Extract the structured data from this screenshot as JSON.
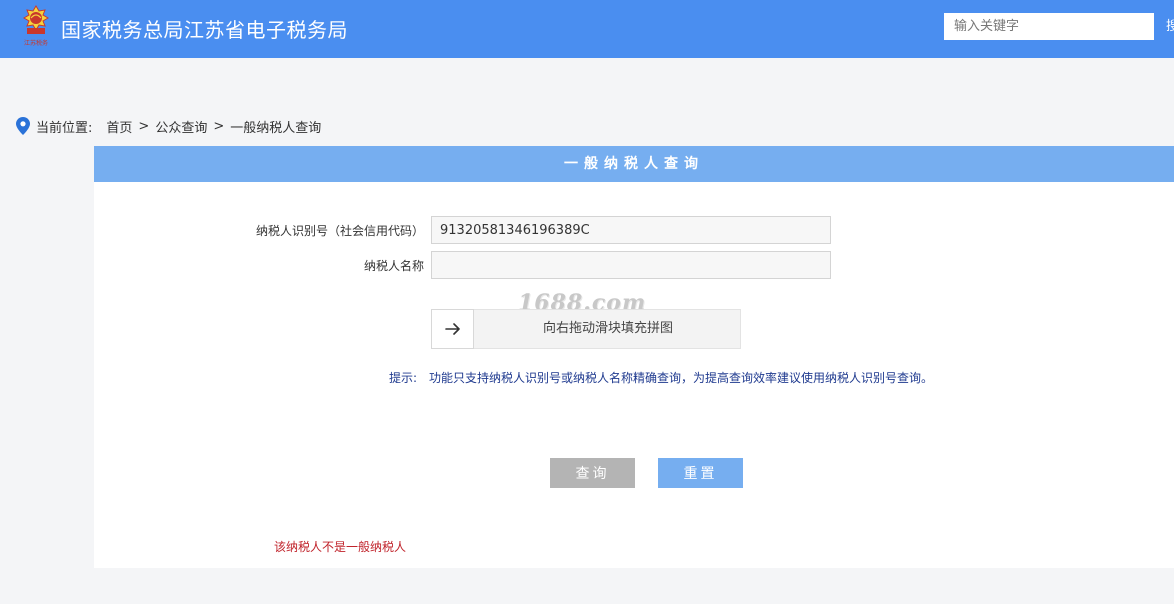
{
  "header": {
    "logo_caption": "江苏税务",
    "site_title": "国家税务总局江苏省电子税务局",
    "search": {
      "placeholder": "输入关键字",
      "value": "",
      "button_label": "搜索"
    }
  },
  "breadcrumb": {
    "label": "当前位置:",
    "items": [
      "首页",
      "公众查询",
      "一般纳税人查询"
    ],
    "separator": ">"
  },
  "panel": {
    "title": "一般纳税人查询",
    "fields": [
      {
        "label": "纳税人识别号（社会信用代码）",
        "value": "91320581346196389C"
      },
      {
        "label": "纳税人名称",
        "value": ""
      }
    ],
    "slider": {
      "text": "向右拖动滑块填充拼图",
      "handle_icon": "arrow-right-icon"
    },
    "watermark": "1688.com",
    "hint": {
      "label": "提示:",
      "text": "功能只支持纳税人识别号或纳税人名称精确查询，为提高查询效率建议使用纳税人识别号查询。"
    },
    "buttons": {
      "query": "查询",
      "reset": "重置"
    },
    "result_message": "该纳税人不是一般纳税人"
  },
  "colors": {
    "header_bg": "#4a8ef0",
    "panel_header_bg": "#76aef0",
    "hint_text": "#1f3a8f",
    "error_text": "#c0222a",
    "query_button_bg": "#b4b4b4",
    "reset_button_bg": "#76aef0"
  }
}
